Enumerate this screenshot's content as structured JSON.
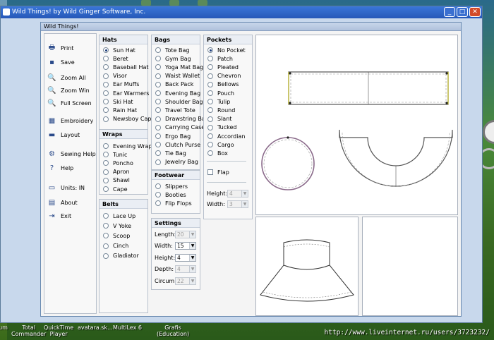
{
  "window": {
    "title": "Wild Things! by Wild Ginger Software, Inc."
  },
  "window_buttons": {
    "minimize": "_",
    "maximize": "□",
    "close": "✕"
  },
  "dialog": {
    "title": "Wild Things!"
  },
  "toolbar": [
    {
      "label": "Print",
      "icon": "printer-icon",
      "glyph": "🖶"
    },
    {
      "label": "Save",
      "icon": "disk-icon",
      "glyph": "▪"
    },
    {
      "label": "Zoom All",
      "icon": "magnifier-icon",
      "glyph": "🔍"
    },
    {
      "label": "Zoom Win",
      "icon": "magnifier-icon",
      "glyph": "🔍"
    },
    {
      "label": "Full Screen",
      "icon": "magnifier-icon",
      "glyph": "🔍"
    },
    {
      "label": "Embroidery",
      "icon": "embroidery-icon",
      "glyph": "▦"
    },
    {
      "label": "Layout",
      "icon": "ruler-icon",
      "glyph": "▬"
    },
    {
      "label": "Sewing Help",
      "icon": "sewing-machine-icon",
      "glyph": "⚙"
    },
    {
      "label": "Help",
      "icon": "help-icon",
      "glyph": "?"
    },
    {
      "label": "Units:  IN",
      "icon": "units-icon",
      "glyph": "▭"
    },
    {
      "label": "About",
      "icon": "about-icon",
      "glyph": "▤"
    },
    {
      "label": "Exit",
      "icon": "exit-door-icon",
      "glyph": "⇥"
    }
  ],
  "hats": {
    "title": "Hats",
    "items": [
      "Sun Hat",
      "Beret",
      "Baseball Hat",
      "Visor",
      "Ear Muffs",
      "Ear Warmers",
      "Ski Hat",
      "Rain Hat",
      "Newsboy Cap"
    ],
    "selected": "Sun Hat"
  },
  "wraps": {
    "title": "Wraps",
    "items": [
      "Evening Wrap",
      "Tunic",
      "Poncho",
      "Apron",
      "Shawl",
      "Cape"
    ]
  },
  "belts": {
    "title": "Belts",
    "items": [
      "Lace Up",
      "V Yoke",
      "Scoop",
      "Cinch",
      "Gladiator"
    ]
  },
  "bags": {
    "title": "Bags",
    "items": [
      "Tote Bag",
      "Gym Bag",
      "Yoga Mat Bag",
      "Waist Wallet",
      "Back Pack",
      "Evening Bag",
      "Shoulder Bag",
      "Travel Tote",
      "Drawstring Bag",
      "Carrying Case",
      "Ergo Bag",
      "Clutch Purse",
      "Tie Bag",
      "Jewelry Bag"
    ]
  },
  "footwear": {
    "title": "Footwear",
    "items": [
      "Slippers",
      "Booties",
      "Flip Flops"
    ]
  },
  "settings": {
    "title": "Settings",
    "rows": [
      {
        "label": "Length:",
        "value": "20",
        "enabled": false
      },
      {
        "label": "Width:",
        "value": "15",
        "enabled": true
      },
      {
        "label": "Height:",
        "value": "4",
        "enabled": true
      },
      {
        "label": "Depth:",
        "value": "4",
        "enabled": false
      },
      {
        "label": "Circum:",
        "value": "22",
        "enabled": false
      }
    ]
  },
  "pockets": {
    "title": "Pockets",
    "items": [
      "No Pocket",
      "Patch",
      "Pleated",
      "Chevron",
      "Bellows",
      "Pouch",
      "Tulip",
      "Round",
      "Slant",
      "Tucked",
      "Accordian",
      "Cargo",
      "Box"
    ],
    "selected": "No Pocket",
    "flap_label": "Flap",
    "height_label": "Height:",
    "height_value": "4",
    "width_label": "Width:",
    "width_value": "3"
  },
  "taskbar": [
    {
      "line1": "um",
      "line2": ""
    },
    {
      "line1": "Total",
      "line2": "Commander"
    },
    {
      "line1": "QuickTime",
      "line2": "Player"
    },
    {
      "line1": "avatara.sk...",
      "line2": ""
    },
    {
      "line1": "MultiLex 6",
      "line2": ""
    },
    {
      "line1": "Grafis",
      "line2": "(Education)"
    }
  ],
  "watermark": "http://www.liveinternet.ru/users/3723232/"
}
